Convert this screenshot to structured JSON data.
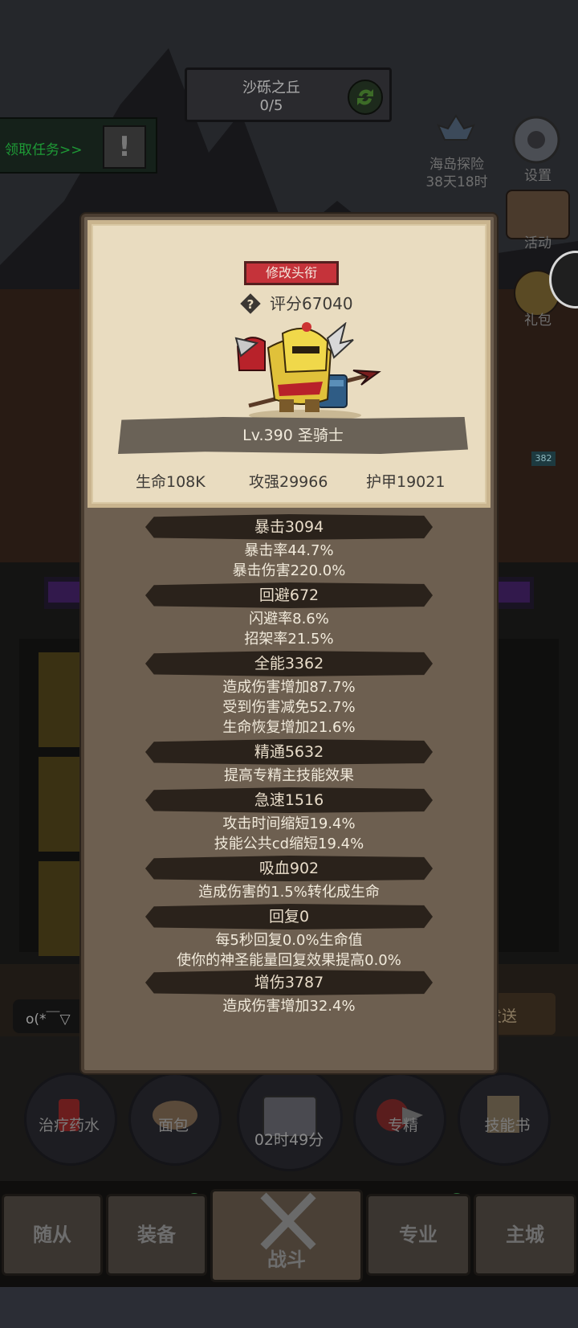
{
  "stage": {
    "name": "沙砾之丘",
    "progress": "0/5"
  },
  "quest": {
    "label": "领取任务>>",
    "alert": "!"
  },
  "side": {
    "explore_label": "海岛探险",
    "explore_timer": "38天18时",
    "settings_label": "设置",
    "activity_label": "活动",
    "gift_label": "礼包",
    "badge_num": "382"
  },
  "card": {
    "rename_button": "修改头衔",
    "score": "评分67040",
    "level_class": "Lv.390 圣骑士",
    "hp": "生命108K",
    "atk": "攻强29966",
    "armor": "护甲19021"
  },
  "stats": {
    "crit": {
      "head": "暴击3094",
      "l1": "暴击率44.7%",
      "l2": "暴击伤害220.0%"
    },
    "dodge": {
      "head": "回避672",
      "l1": "闪避率8.6%",
      "l2": "招架率21.5%"
    },
    "vers": {
      "head": "全能3362",
      "l1": "造成伤害增加87.7%",
      "l2": "受到伤害减免52.7%",
      "l3": "生命恢复增加21.6%"
    },
    "mastery": {
      "head": "精通5632",
      "l1": "提高专精主技能效果"
    },
    "haste": {
      "head": "急速1516",
      "l1": "攻击时间缩短19.4%",
      "l2": "技能公共cd缩短19.4%"
    },
    "leech": {
      "head": "吸血902",
      "l1": "造成伤害的1.5%转化成生命"
    },
    "regen": {
      "head": "回复0",
      "l1": "每5秒回复0.0%生命值",
      "l2": "使你的神圣能量回复效果提高0.0%"
    },
    "dmg": {
      "head": "增伤3787",
      "l1": "造成伤害增加32.4%"
    }
  },
  "chat": {
    "prefix": "o(*￣▽",
    "send": "发送"
  },
  "bottom": {
    "potion": "治疗药水",
    "bread": "面包",
    "chest_timer": "02时49分",
    "spec": "专精",
    "skillbook": "技能书"
  },
  "tabs": {
    "followers": "随从",
    "equipment": "装备",
    "battle": "战斗",
    "profession": "专业",
    "city": "主城"
  },
  "colors": {
    "panel": "#6d5f50",
    "card": "#e9dcc0",
    "accent_red": "#c5333a",
    "stat_bar": "#2a221b"
  }
}
